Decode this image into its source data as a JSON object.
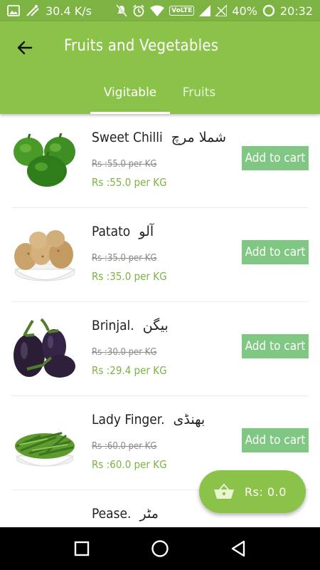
{
  "status_bar": {
    "speed": "30.4 K/s",
    "network": "VoLTE",
    "battery": "40%",
    "time": "20:32"
  },
  "app_bar": {
    "title": "Fruits and Vegetables"
  },
  "tabs": [
    {
      "label": "Vigitable",
      "selected": true
    },
    {
      "label": "Fruits",
      "selected": false
    }
  ],
  "items": [
    {
      "name": "Sweet Chilli",
      "urdu": "شملا مرچ",
      "old_price": "Rs :55.0 per KG",
      "new_price": "Rs :55.0 per KG",
      "button": "Add to cart"
    },
    {
      "name": "Patato",
      "urdu": "آلو",
      "old_price": "Rs :35.0 per KG",
      "new_price": "Rs :35.0 per KG",
      "button": "Add to cart"
    },
    {
      "name": "Brinjal.",
      "urdu": "بیگن",
      "old_price": "Rs :30.0 per KG",
      "new_price": "Rs :29.4 per KG",
      "button": "Add to cart"
    },
    {
      "name": "Lady Finger.",
      "urdu": "بھنڈی",
      "old_price": "Rs :60.0 per KG",
      "new_price": "Rs :60.0 per KG",
      "button": "Add to cart"
    },
    {
      "name": "Pease.",
      "urdu": "مٹر",
      "old_price": "",
      "new_price": "",
      "button": ""
    }
  ],
  "cart": {
    "total": "Rs: 0.0"
  },
  "colors": {
    "primary": "#8bc34a",
    "status_bar": "#7cb342",
    "price": "#7cb342",
    "button": "#81c784"
  }
}
